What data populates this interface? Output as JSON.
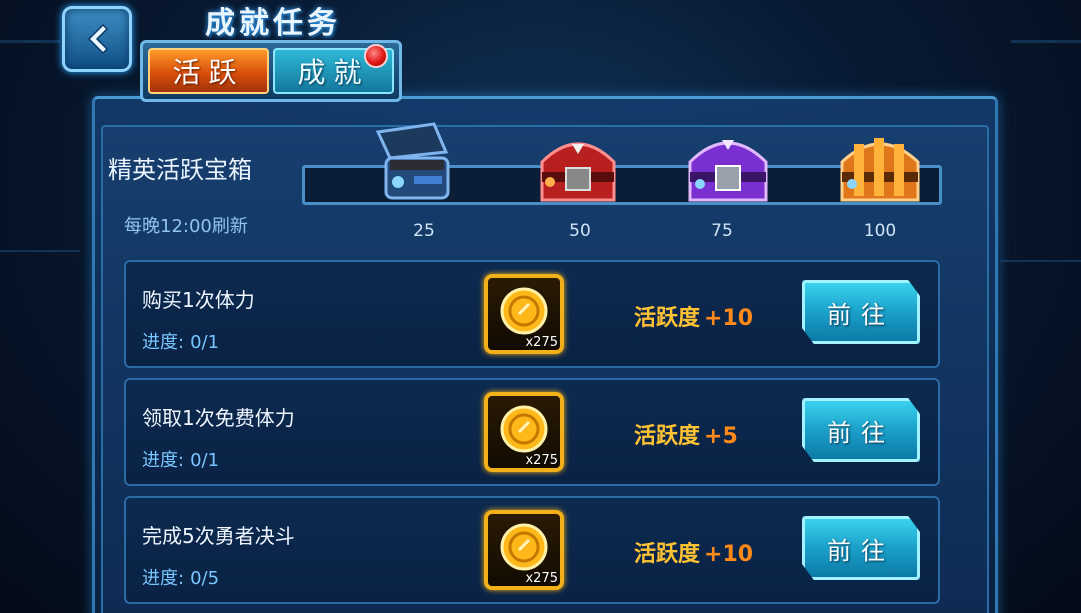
{
  "header": {
    "title": "成就任务",
    "back_icon": "chevron-left-icon"
  },
  "tabs": [
    {
      "label": "活跃",
      "active": true
    },
    {
      "label": "成就",
      "active": false,
      "has_notification": true
    }
  ],
  "chest_section": {
    "title": "精英活跃宝箱",
    "refresh_note": "每晚12:00刷新",
    "progress_fraction": 0.0,
    "milestones": [
      {
        "value": "25",
        "chest_icon": "blue-chest-icon",
        "color": "#3f7fd6"
      },
      {
        "value": "50",
        "chest_icon": "red-chest-icon",
        "color": "#d63a3a"
      },
      {
        "value": "75",
        "chest_icon": "purple-chest-icon",
        "color": "#9a4ae6"
      },
      {
        "value": "100",
        "chest_icon": "orange-chest-icon",
        "color": "#f08a1a"
      }
    ]
  },
  "tasks": [
    {
      "name": "购买1次体力",
      "progress_label": "进度:",
      "progress": "0/1",
      "reward_icon": "gold-coin-icon",
      "reward_qty": "x275",
      "activity_label": "活跃度",
      "activity_points": "+10",
      "button": "前往"
    },
    {
      "name": "领取1次免费体力",
      "progress_label": "进度:",
      "progress": "0/1",
      "reward_icon": "gold-coin-icon",
      "reward_qty": "x275",
      "activity_label": "活跃度",
      "activity_points": "+5",
      "button": "前往"
    },
    {
      "name": "完成5次勇者决斗",
      "progress_label": "进度:",
      "progress": "0/5",
      "reward_icon": "gold-coin-icon",
      "reward_qty": "x275",
      "activity_label": "活跃度",
      "activity_points": "+10",
      "button": "前往"
    }
  ],
  "colors": {
    "accent_orange": "#e0641a",
    "accent_cyan": "#1aa0c9",
    "gold": "#ffc233"
  }
}
